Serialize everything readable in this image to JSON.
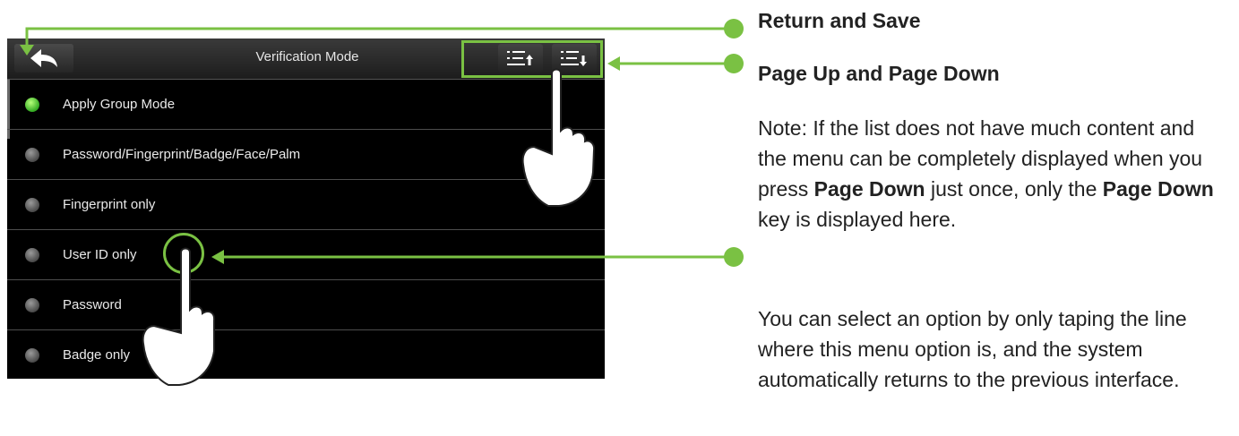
{
  "screen": {
    "title": "Verification Mode",
    "back_icon": "back-arrow-icon",
    "page_up_icon": "page-up-icon",
    "page_down_icon": "page-down-icon",
    "options": [
      {
        "label": "Apply Group Mode",
        "selected": true
      },
      {
        "label": "Password/Fingerprint/Badge/Face/Palm",
        "selected": false
      },
      {
        "label": "Fingerprint only",
        "selected": false
      },
      {
        "label": "User ID only",
        "selected": false
      },
      {
        "label": "Password",
        "selected": false
      },
      {
        "label": "Badge only",
        "selected": false
      }
    ]
  },
  "annotations": {
    "return_save": "Return and Save",
    "page_up_down": "Page Up and Page Down",
    "note": {
      "t1": "Note: If the list does not have much content and the menu can be completely displayed when you press ",
      "b1": "Page Down",
      "t2": " just once, only the ",
      "b2": "Page Down",
      "t3": " key is displayed here."
    },
    "select_text": "You can select an option by only taping the line where this menu option is, and the system automatically returns to the previous interface."
  },
  "colors": {
    "accent_green": "#7ac143",
    "screen_bg": "#000000",
    "radio_selected": "#33aa22"
  }
}
